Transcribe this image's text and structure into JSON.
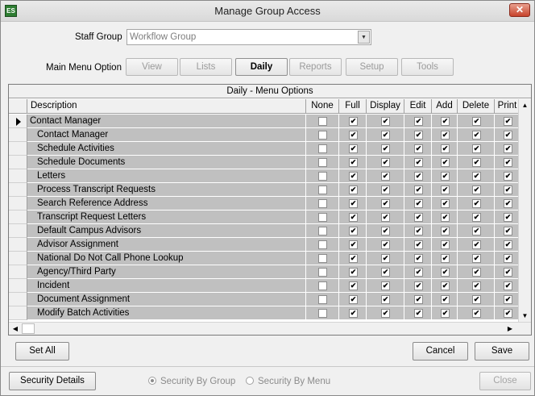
{
  "window": {
    "title": "Manage Group Access",
    "close_glyph": "✕",
    "app_icon": "ES"
  },
  "staff_group": {
    "label": "Staff Group",
    "value": "Workflow Group"
  },
  "main_menu": {
    "label": "Main Menu Option",
    "buttons": [
      {
        "label": "View",
        "active": false
      },
      {
        "label": "Lists",
        "active": false
      },
      {
        "label": "Daily",
        "active": true
      },
      {
        "label": "Reports",
        "active": false
      },
      {
        "label": "Setup",
        "active": false
      },
      {
        "label": "Tools",
        "active": false
      }
    ]
  },
  "grid": {
    "caption": "Daily - Menu Options",
    "columns": [
      "Description",
      "None",
      "Full",
      "Display",
      "Edit",
      "Add",
      "Delete",
      "Print"
    ],
    "rows": [
      {
        "description": "Contact Manager",
        "child": false,
        "current": true,
        "checks": [
          false,
          true,
          true,
          true,
          true,
          true,
          true
        ]
      },
      {
        "description": "Contact Manager",
        "child": true,
        "checks": [
          false,
          true,
          true,
          true,
          true,
          true,
          true
        ]
      },
      {
        "description": "Schedule Activities",
        "child": true,
        "checks": [
          false,
          true,
          true,
          true,
          true,
          true,
          true
        ]
      },
      {
        "description": "Schedule Documents",
        "child": true,
        "checks": [
          false,
          true,
          true,
          true,
          true,
          true,
          true
        ]
      },
      {
        "description": "Letters",
        "child": true,
        "checks": [
          false,
          true,
          true,
          true,
          true,
          true,
          true
        ]
      },
      {
        "description": "Process Transcript Requests",
        "child": true,
        "checks": [
          false,
          true,
          true,
          true,
          true,
          true,
          true
        ]
      },
      {
        "description": "Search Reference Address",
        "child": true,
        "checks": [
          false,
          true,
          true,
          true,
          true,
          true,
          true
        ]
      },
      {
        "description": "Transcript Request Letters",
        "child": true,
        "checks": [
          false,
          true,
          true,
          true,
          true,
          true,
          true
        ]
      },
      {
        "description": "Default Campus Advisors",
        "child": true,
        "checks": [
          false,
          true,
          true,
          true,
          true,
          true,
          true
        ]
      },
      {
        "description": "Advisor Assignment",
        "child": true,
        "checks": [
          false,
          true,
          true,
          true,
          true,
          true,
          true
        ]
      },
      {
        "description": "National Do Not Call Phone Lookup",
        "child": true,
        "checks": [
          false,
          true,
          true,
          true,
          true,
          true,
          true
        ]
      },
      {
        "description": "Agency/Third Party",
        "child": true,
        "checks": [
          false,
          true,
          true,
          true,
          true,
          true,
          true
        ]
      },
      {
        "description": "Incident",
        "child": true,
        "checks": [
          false,
          true,
          true,
          true,
          true,
          true,
          true
        ]
      },
      {
        "description": "Document Assignment",
        "child": true,
        "checks": [
          false,
          true,
          true,
          true,
          true,
          true,
          true
        ]
      },
      {
        "description": "Modify Batch Activities",
        "child": true,
        "checks": [
          false,
          true,
          true,
          true,
          true,
          true,
          true
        ]
      }
    ]
  },
  "buttons": {
    "set_all": "Set All",
    "cancel": "Cancel",
    "save": "Save",
    "security_details": "Security Details",
    "close": "Close"
  },
  "security_mode": {
    "by_group": "Security By Group",
    "by_menu": "Security By Menu",
    "selected": "by_group"
  },
  "colors": {
    "row_fill": "#c0c0c0",
    "disabled_text": "#9b9b9b"
  }
}
